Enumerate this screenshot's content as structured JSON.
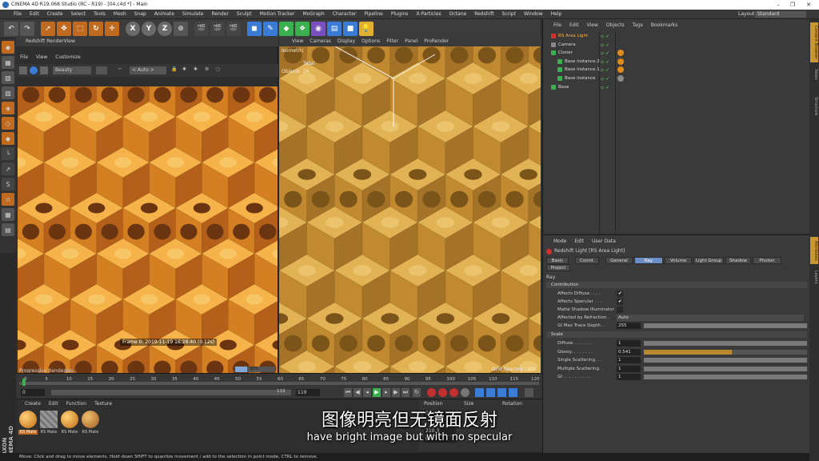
{
  "window": {
    "title": "CINEMA 4D R19.068 Studio (RC - R19) - [04.c4d *] - Main",
    "controls": [
      "–",
      "❐",
      "✕"
    ]
  },
  "menubar": [
    "File",
    "Edit",
    "Create",
    "Select",
    "Tools",
    "Mesh",
    "Snap",
    "Animate",
    "Simulate",
    "Render",
    "Sculpt",
    "Motion Tracker",
    "MoGraph",
    "Character",
    "Pipeline",
    "Plugins",
    "X-Particles",
    "Octane",
    "Redshift",
    "Script",
    "Window",
    "Help"
  ],
  "layout": {
    "label": "Layout:",
    "value": "Standard"
  },
  "toolbar": {
    "axis_x": "X",
    "axis_y": "Y",
    "axis_z": "Z"
  },
  "renderview": {
    "title": "Redshift RenderView",
    "menu": [
      "File",
      "View",
      "Customize"
    ],
    "aov": "Beauty",
    "camera": "< Auto >",
    "frame_info": "Frame  0:  2019-11-19  16:28:40  (0.12s)",
    "progress": "Progressive Rendering...",
    "progress_pct": 0.3,
    "progress_label": "30%"
  },
  "viewport": {
    "menu": [
      "View",
      "Cameras",
      "Display",
      "Options",
      "Filter",
      "Panel",
      "ProRender"
    ],
    "camera_name": "Isometric",
    "total_label": "Total",
    "objects_label": "Objects",
    "objects_value": "26",
    "grid_spacing": "Grid Spacing : 100"
  },
  "object_manager": {
    "menu": [
      "File",
      "Edit",
      "View",
      "Objects",
      "Tags",
      "Bookmarks"
    ],
    "objects": [
      {
        "name": "RS Area Light",
        "indent": 0,
        "selected": true,
        "tag_color": ""
      },
      {
        "name": "Camera",
        "indent": 0,
        "selected": false,
        "tag_color": ""
      },
      {
        "name": "Cloner",
        "indent": 0,
        "selected": false,
        "tag_color": "#e08a1e"
      },
      {
        "name": "Base instance.2",
        "indent": 1,
        "selected": false,
        "tag_color": "#e08a1e"
      },
      {
        "name": "Base instance.1",
        "indent": 1,
        "selected": false,
        "tag_color": "#e08a1e"
      },
      {
        "name": "Base instance",
        "indent": 1,
        "selected": false,
        "tag_color": "#8a8a8a"
      },
      {
        "name": "Base",
        "indent": 0,
        "selected": false,
        "tag_color": ""
      }
    ]
  },
  "attribute_manager": {
    "menu": [
      "Mode",
      "Edit",
      "User Data"
    ],
    "object_name": "Redshift Light [RS Area Light]",
    "tabs": [
      "Basic",
      "Coord.",
      "General",
      "Ray",
      "Volume",
      "Light Group",
      "Shadow",
      "Photon",
      "Project"
    ],
    "active_tab": "Ray",
    "section_title": "Ray",
    "contribution_header": "Contribution",
    "contribution": [
      {
        "label": "Affects Diffuse . . . .",
        "value": "✔"
      },
      {
        "label": "Affects Specular . . .",
        "value": "✔"
      },
      {
        "label": "Matte Shadow Illuminator",
        "value": ""
      },
      {
        "label": "Affected by Refraction .",
        "value": "Auto"
      },
      {
        "label": "GI Max Trace Depth . .",
        "value": "255"
      }
    ],
    "scale_header": "Scale",
    "scale": [
      {
        "label": "Diffuse . . . . . . .",
        "value": "1",
        "fill": 1.0
      },
      {
        "label": "Glossy. . . . . . . .",
        "value": "0.541",
        "fill": 0.541
      },
      {
        "label": "Single Scattering. . .",
        "value": "1",
        "fill": 1.0
      },
      {
        "label": "Multiple Scattering. .",
        "value": "1",
        "fill": 1.0
      },
      {
        "label": "GI . . . . . . . . . .",
        "value": "1",
        "fill": 1.0
      }
    ]
  },
  "right_tabs": [
    "Content Browser",
    "Takes",
    "Structure",
    "Attributes",
    "Layers"
  ],
  "timeline": {
    "ticks": [
      "0",
      "5",
      "10",
      "15",
      "20",
      "25",
      "30",
      "35",
      "40",
      "45",
      "50",
      "55",
      "60",
      "65",
      "70",
      "75",
      "80",
      "85",
      "90",
      "95",
      "100",
      "105",
      "110",
      "115",
      "120"
    ],
    "current_frame": "0",
    "start_field": "0",
    "end_field": "119",
    "end_field2": "119",
    "frame_indicator": "0 F"
  },
  "materials": {
    "menu": [
      "Create",
      "Edit",
      "Function",
      "Texture"
    ],
    "items": [
      "RS Mate",
      "RS Mate",
      "RS Mate",
      "RS Mate"
    ]
  },
  "coordinates": {
    "headers": [
      "Position",
      "Size",
      "Rotation"
    ],
    "row_x": "0 cm",
    "row_y": "210.3",
    "row_z": "0"
  },
  "status": "Move: Click and drag to move elements. Hold down SHIFT to quantize movement / add to the selection in point mode, CTRL to remove.",
  "subtitles": {
    "zh": "图像明亮但无镜面反射",
    "en": "have bright image but with no specular"
  },
  "brand": "MAXON CINEMA 4D"
}
